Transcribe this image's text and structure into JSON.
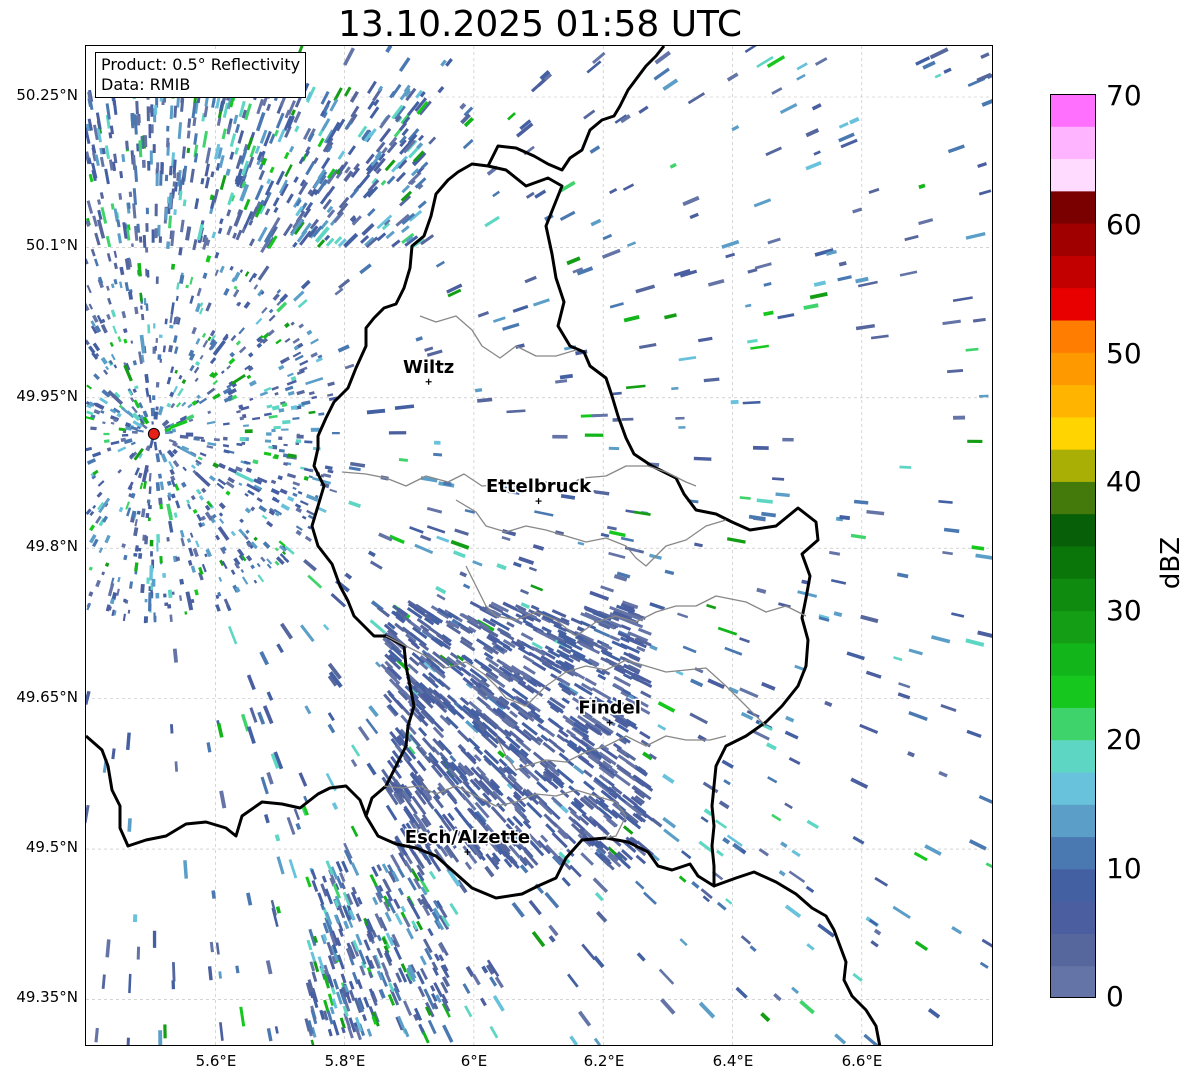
{
  "title": "13.10.2025 01:58 UTC",
  "info": {
    "product": "Product: 0.5° Reflectivity",
    "data": "Data: RMIB"
  },
  "axes": {
    "lat_labels": [
      "50.25°N",
      "50.1°N",
      "49.95°N",
      "49.8°N",
      "49.65°N",
      "49.5°N",
      "49.35°N"
    ],
    "lon_labels": [
      "5.6°E",
      "5.8°E",
      "6°E",
      "6.2°E",
      "6.4°E",
      "6.6°E"
    ]
  },
  "cities": [
    {
      "name": "Wiltz",
      "lon": 5.93,
      "lat": 49.966
    },
    {
      "name": "Ettelbruck",
      "lon": 6.1,
      "lat": 49.847
    },
    {
      "name": "Findel",
      "lon": 6.21,
      "lat": 49.626
    },
    {
      "name": "Esch/Alzette",
      "lon": 5.99,
      "lat": 49.497
    }
  ],
  "radar_site": {
    "lon": 5.505,
    "lat": 49.914,
    "color": "#e8201a"
  },
  "colorbar": {
    "label": "dBZ",
    "min": 0,
    "max": 70,
    "step": 2.5,
    "ticks": [
      "0",
      "10",
      "20",
      "30",
      "40",
      "50",
      "60",
      "70"
    ],
    "colors": [
      "#6474a6",
      "#56679e",
      "#4a5ea0",
      "#4360a3",
      "#4a79b2",
      "#5b9ec8",
      "#68c2dc",
      "#5ed6c4",
      "#3fd46b",
      "#16c81e",
      "#12b51a",
      "#139e15",
      "#0f8c0f",
      "#0a760a",
      "#075f07",
      "#437a0b",
      "#aaaf06",
      "#ffd400",
      "#ffb400",
      "#ff9900",
      "#ff7d00",
      "#e80000",
      "#c20000",
      "#a00000",
      "#7a0000",
      "#ffdcff",
      "#ffb4ff",
      "#ff70ff",
      "#e63ce6"
    ]
  }
}
